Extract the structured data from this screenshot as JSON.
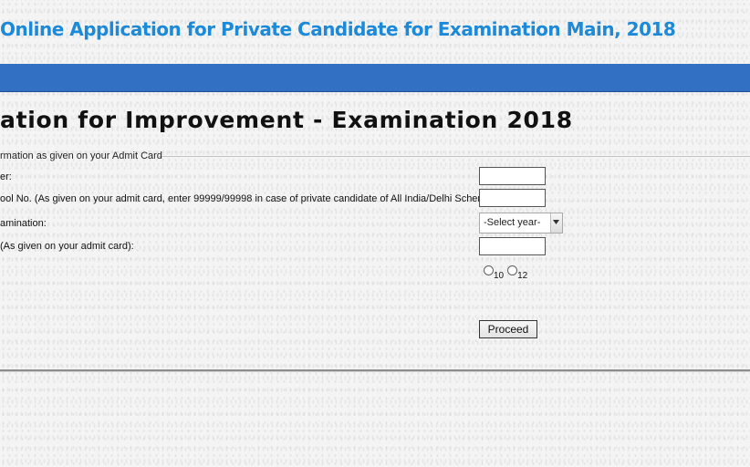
{
  "header": {
    "title": "Online Application for Private Candidate for Examination Main, 2018"
  },
  "page": {
    "heading": "ation for Improvement - Examination 2018"
  },
  "form": {
    "legend": "rmation as given on your Admit Card",
    "fields": [
      {
        "label": "er:",
        "value": ""
      },
      {
        "label": "ool No. (As given on your admit card, enter 99999/99998 in case of private candidate of All India/Delhi Scheme):",
        "value": ""
      },
      {
        "label": "amination:",
        "selected": "-Select year-"
      },
      {
        "label": "(As given on your admit card):",
        "value": ""
      }
    ],
    "radio_options": [
      {
        "label": "10",
        "checked": false
      },
      {
        "label": "12",
        "checked": false
      }
    ],
    "proceed_label": "Proceed"
  },
  "colors": {
    "title": "#1c8ad8",
    "nav_bar": "#3270c3"
  }
}
